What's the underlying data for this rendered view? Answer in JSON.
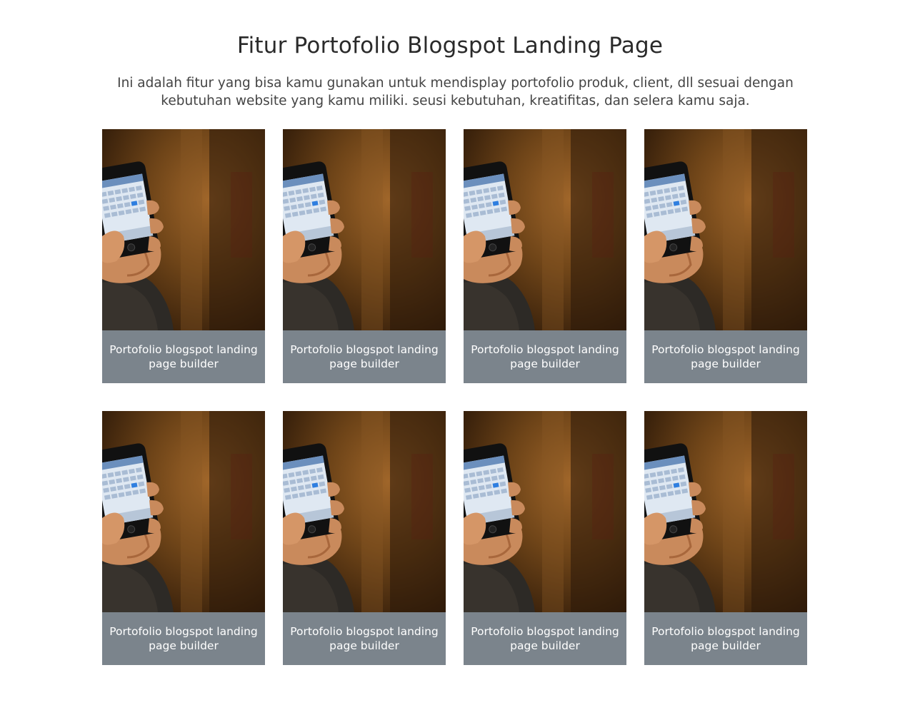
{
  "section": {
    "title": "Fitur Portofolio Blogspot Landing Page",
    "description": "Ini adalah fitur yang bisa kamu gunakan untuk mendisplay portofolio produk, client, dll sesuai dengan kebutuhan website yang kamu miliki. seusi kebutuhan, kreatifitas, dan selera kamu saja."
  },
  "portfolio": {
    "items": [
      {
        "caption": "Portofolio blogspot landing page builder",
        "image": "hand-holding-phone-calendar"
      },
      {
        "caption": "Portofolio blogspot landing page builder",
        "image": "hand-holding-phone-calendar"
      },
      {
        "caption": "Portofolio blogspot landing page builder",
        "image": "hand-holding-phone-calendar"
      },
      {
        "caption": "Portofolio blogspot landing page builder",
        "image": "hand-holding-phone-calendar"
      },
      {
        "caption": "Portofolio blogspot landing page builder",
        "image": "hand-holding-phone-calendar"
      },
      {
        "caption": "Portofolio blogspot landing page builder",
        "image": "hand-holding-phone-calendar"
      },
      {
        "caption": "Portofolio blogspot landing page builder",
        "image": "hand-holding-phone-calendar"
      },
      {
        "caption": "Portofolio blogspot landing page builder",
        "image": "hand-holding-phone-calendar"
      }
    ]
  },
  "colors": {
    "caption_background": "#7b848c",
    "caption_text": "#ffffff",
    "title_text": "#2a2a2a",
    "description_text": "#444444"
  }
}
